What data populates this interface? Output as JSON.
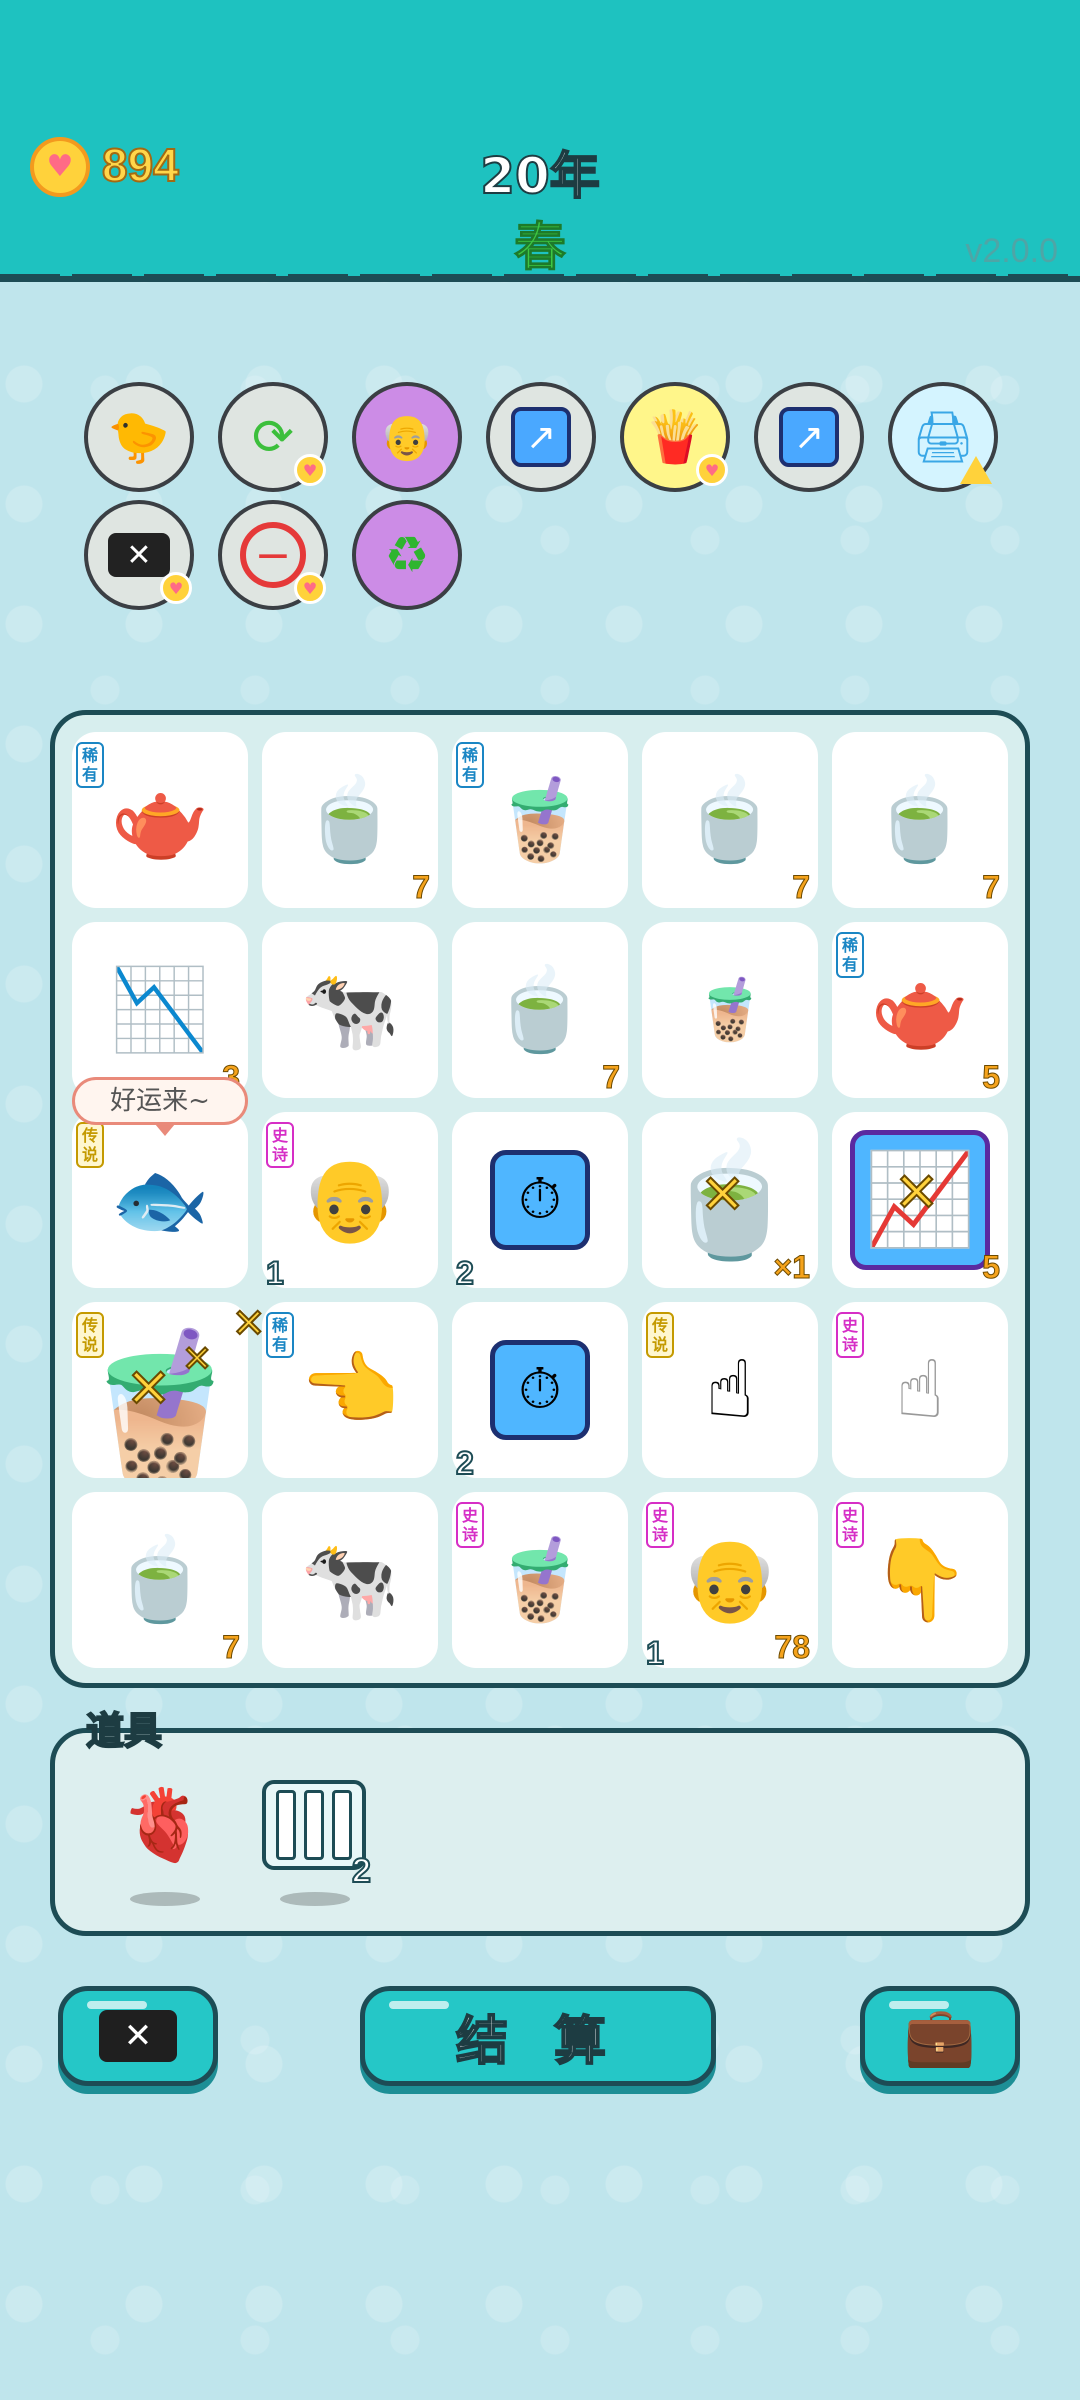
{
  "header": {
    "coins": "894",
    "year": "20年",
    "season": "春",
    "version": "v2.0.0"
  },
  "tools_row1": [
    "chick-egg-icon",
    "refresh-icon",
    "math-grandpa-icon",
    "up-arrow-card-icon",
    "fries-icon",
    "up-arrow-card-icon",
    "printer-icon"
  ],
  "tools_row2": [
    "delete-card-icon",
    "minus-icon",
    "recycle-icon"
  ],
  "board": {
    "tags": {
      "rare": "稀有",
      "epic": "史诗",
      "legend": "传说"
    },
    "bubble": "好运来~",
    "counts": {
      "r0c1": "7",
      "r0c3": "7",
      "r0c4": "7",
      "r1c0": "3",
      "r1c2": "7",
      "r1c4": "5",
      "r2c1": "1",
      "r2c2": "2",
      "r2c3": "×1",
      "r2c4": "5",
      "r3c2": "2",
      "r4c0": "7",
      "r4c3_left": "1",
      "r4c3_right": "78"
    }
  },
  "props": {
    "title": "道具",
    "items": [
      {
        "name": "liver",
        "count": ""
      },
      {
        "name": "glass-tubes",
        "count": "2"
      }
    ]
  },
  "buttons": {
    "settle": "结 算"
  }
}
